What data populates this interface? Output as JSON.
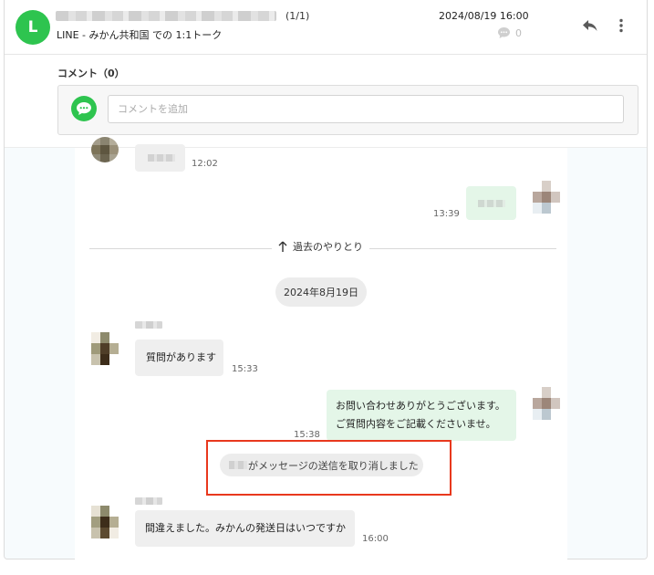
{
  "header": {
    "avatar_letter": "L",
    "count": "(1/1)",
    "subtitle": "LINE - みかん共和国 での 1:1トーク",
    "datetime": "2024/08/19 16:00",
    "comment_count": "0",
    "icons": {
      "comment": "speech-bubble-icon",
      "reply": "reply-arrow-icon",
      "more": "vertical-dots-icon"
    }
  },
  "comments": {
    "label": "コメント（0）",
    "placeholder": "コメントを追加",
    "value": "",
    "icon": "chat-bubble-icon"
  },
  "chat": {
    "messages": [
      {
        "direction": "in",
        "text": "",
        "time": "12:02"
      },
      {
        "direction": "out",
        "text": "",
        "time": "13:39"
      }
    ],
    "divider_label": "過去のやりとり",
    "date_label": "2024年8月19日",
    "messages2": [
      {
        "direction": "in",
        "text": "質問があります",
        "time": "15:33"
      },
      {
        "direction": "out",
        "text": [
          "お問い合わせありがとうございます。",
          "ご質問内容をご記載くださいませ。"
        ],
        "time": "15:38"
      },
      {
        "direction": "system",
        "text": "がメッセージの送信を取り消しました"
      },
      {
        "direction": "in",
        "text": "間違えました。みかんの発送日はいつですか",
        "time": "16:00"
      }
    ]
  },
  "colors": {
    "line_green": "#2ec44f",
    "outgoing_bubble": "#e4f6e8",
    "incoming_bubble": "#efefef",
    "highlight_red": "#e8381d"
  }
}
